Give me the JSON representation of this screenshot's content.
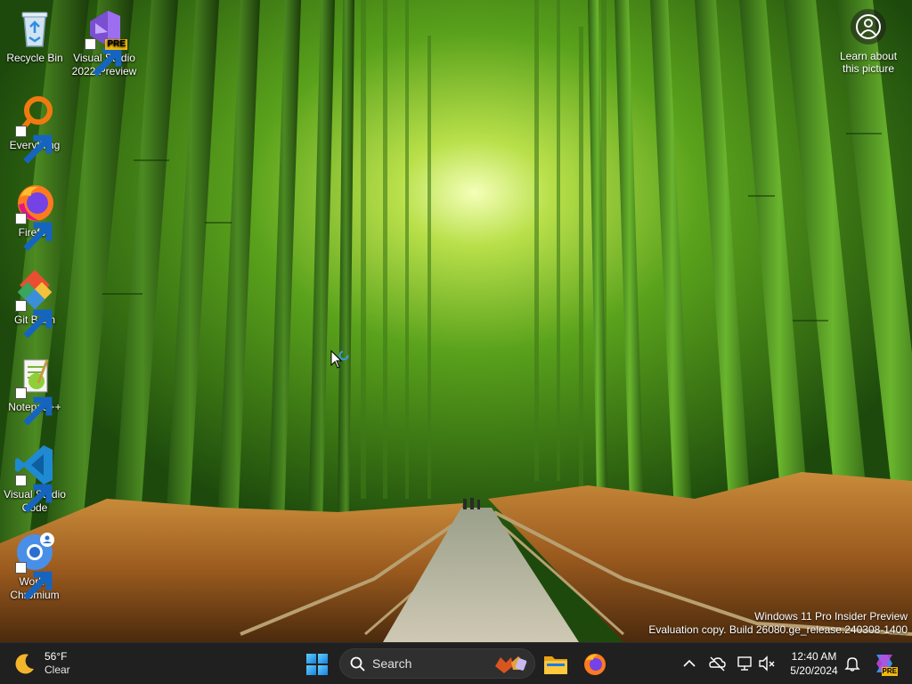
{
  "desktop": {
    "icons": [
      {
        "label": "Recycle Bin",
        "icon": "recycle-bin-icon"
      },
      {
        "label_line1": "Visual Studio",
        "label_line2": "2022 Preview",
        "badge": "PRE",
        "icon": "visual-studio-preview-icon"
      },
      {
        "label": "Everything",
        "icon": "everything-search-icon"
      },
      {
        "label": "Firefox",
        "icon": "firefox-icon"
      },
      {
        "label": "Git Bash",
        "icon": "git-bash-icon"
      },
      {
        "label": "Notepad++",
        "icon": "notepad-plus-plus-icon"
      },
      {
        "label_line1": "Visual Studio",
        "label_line2": "Code",
        "icon": "vscode-icon"
      },
      {
        "label_line1": "Work -",
        "label_line2": "Chromium",
        "icon": "chromium-work-profile-icon"
      }
    ],
    "learn_picture": {
      "line1": "Learn about",
      "line2": "this picture",
      "icon": "camera-circle-icon"
    },
    "watermark": {
      "line1": "Windows 11 Pro Insider Preview",
      "line2": "Evaluation copy. Build 26080.ge_release.240308-1400"
    }
  },
  "taskbar": {
    "weather": {
      "temp": "56°F",
      "condition": "Clear",
      "icon": "moon-icon"
    },
    "start_icon": "windows-logo-icon",
    "search": {
      "label": "Search",
      "icon": "search-icon",
      "highlight": "autumn-leaves-icon"
    },
    "pinned": [
      {
        "name": "file-explorer",
        "icon": "folder-icon"
      },
      {
        "name": "firefox",
        "icon": "firefox-icon"
      }
    ],
    "tray": {
      "icons": [
        "chevron-up-icon",
        "onedrive-off-icon",
        "network-icon",
        "volume-muted-icon"
      ],
      "time": "12:40 AM",
      "date": "5/20/2024",
      "notification_icon": "bell-icon",
      "copilot_badge": "PRE"
    }
  }
}
